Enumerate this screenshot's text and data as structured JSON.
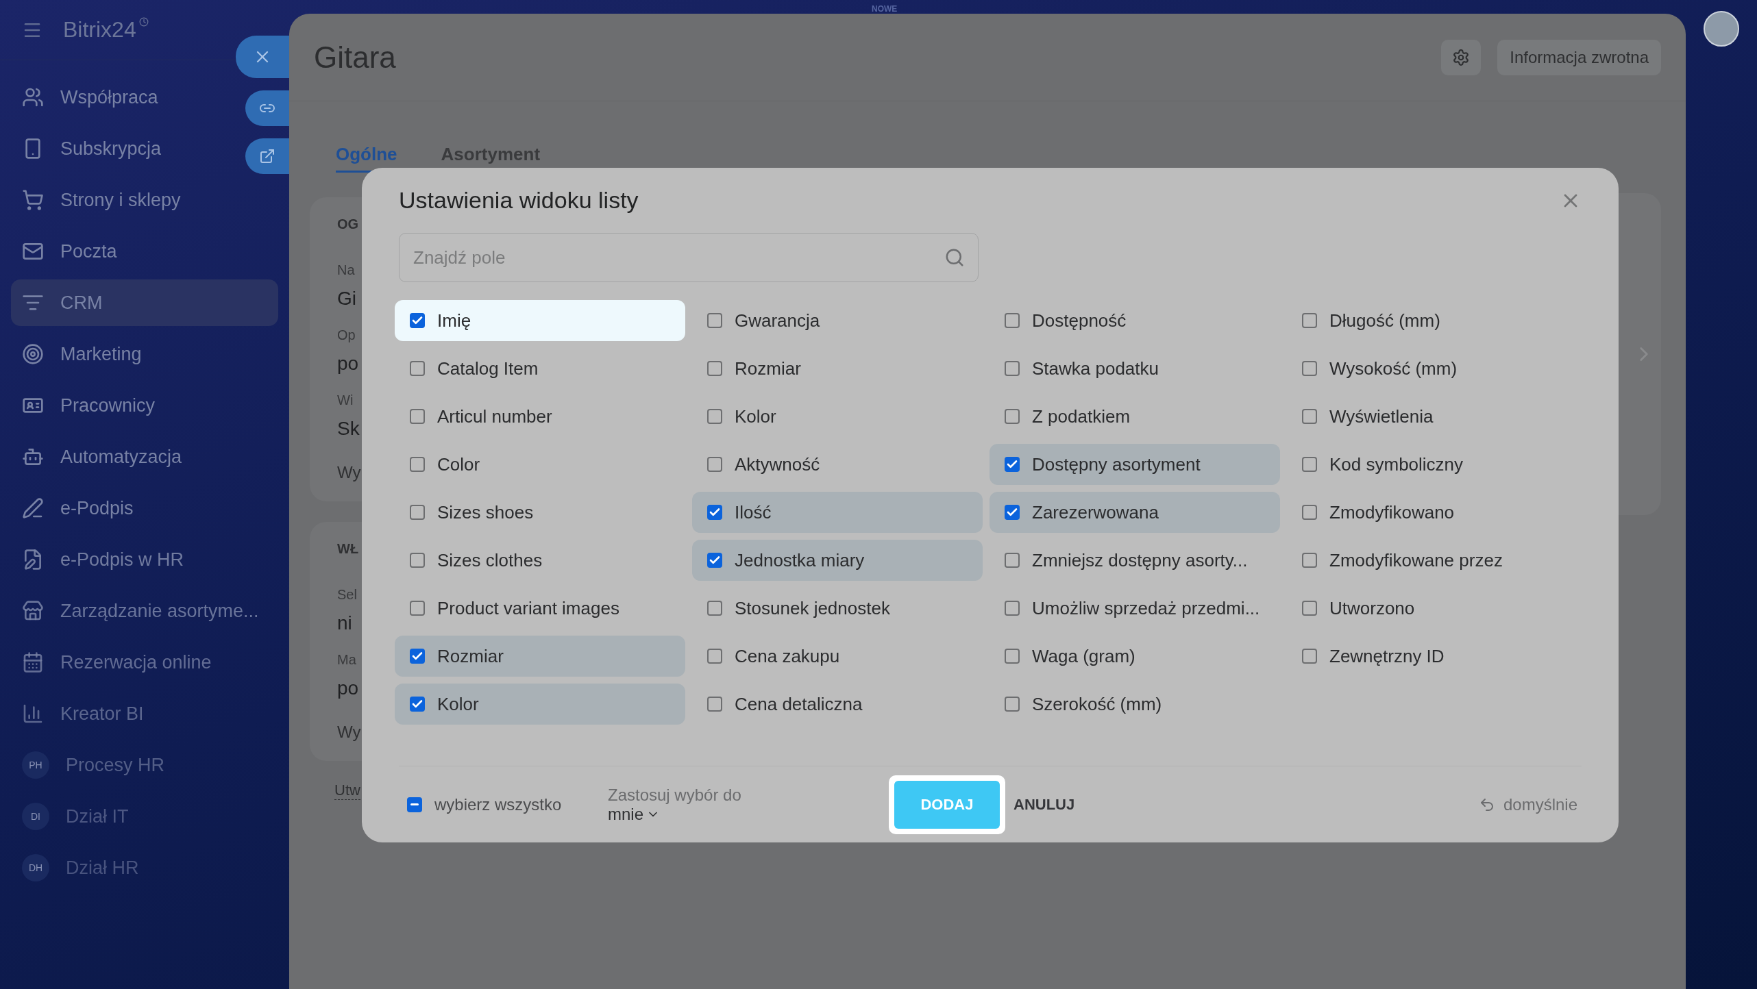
{
  "sidebar": {
    "logo": "Bitrix24",
    "items": [
      {
        "label": "Współpraca",
        "kind": "icon",
        "selected": false
      },
      {
        "label": "Subskrypcja",
        "kind": "icon",
        "selected": false
      },
      {
        "label": "Strony i sklepy",
        "kind": "icon",
        "selected": false
      },
      {
        "label": "Poczta",
        "kind": "icon",
        "selected": false
      },
      {
        "label": "CRM",
        "kind": "icon",
        "selected": true
      },
      {
        "label": "Marketing",
        "kind": "icon",
        "selected": false
      },
      {
        "label": "Pracownicy",
        "kind": "icon",
        "selected": false
      },
      {
        "label": "Automatyzacja",
        "kind": "icon",
        "selected": false
      },
      {
        "label": "e-Podpis",
        "kind": "icon",
        "selected": false
      },
      {
        "label": "e-Podpis w HR",
        "kind": "icon",
        "selected": false
      },
      {
        "label": "Zarządzanie asortyme...",
        "kind": "icon",
        "selected": false
      },
      {
        "label": "Rezerwacja online",
        "kind": "icon",
        "selected": false
      },
      {
        "label": "Kreator BI",
        "kind": "icon",
        "selected": false
      },
      {
        "label": "Procesy HR",
        "kind": "initials",
        "initials": "PH",
        "selected": false
      },
      {
        "label": "Dział IT",
        "kind": "initials",
        "initials": "DI",
        "selected": false
      },
      {
        "label": "Dział HR",
        "kind": "initials",
        "initials": "DH",
        "selected": false
      }
    ]
  },
  "top_badge": "NOWE",
  "panel": {
    "title": "Gitara",
    "feedback_button": "Informacja zwrotna",
    "tabs": [
      {
        "label": "Ogólne",
        "selected": true
      },
      {
        "label": "Asortyment",
        "selected": false
      }
    ],
    "sections": [
      {
        "heading": "OG",
        "fields": [
          {
            "label": "Na",
            "value": "Gi"
          },
          {
            "label": "Op",
            "value": "po"
          },
          {
            "label": "Wi",
            "value": "Sk"
          }
        ],
        "link": "Wy"
      },
      {
        "heading": "WŁ",
        "fields": [
          {
            "label": "Sel",
            "value": "ni"
          },
          {
            "label": "Ma",
            "value": "po"
          }
        ],
        "link": "Wy"
      }
    ],
    "footer_link": "Utw"
  },
  "dialog": {
    "title": "Ustawienia widoku listy",
    "search": {
      "placeholder": "Znajdź pole"
    },
    "columns": [
      [
        {
          "label": "Imię",
          "checked": true,
          "focused": true
        },
        {
          "label": "Catalog Item",
          "checked": false,
          "focused": false
        },
        {
          "label": "Articul number",
          "checked": false,
          "focused": false
        },
        {
          "label": "Color",
          "checked": false,
          "focused": false
        },
        {
          "label": "Sizes shoes",
          "checked": false,
          "focused": false
        },
        {
          "label": "Sizes clothes",
          "checked": false,
          "focused": false
        },
        {
          "label": "Product variant images",
          "checked": false,
          "focused": false
        },
        {
          "label": "Rozmiar",
          "checked": true,
          "focused": false
        },
        {
          "label": "Kolor",
          "checked": true,
          "focused": false
        }
      ],
      [
        {
          "label": "Gwarancja",
          "checked": false,
          "focused": false
        },
        {
          "label": "Rozmiar",
          "checked": false,
          "focused": false
        },
        {
          "label": "Kolor",
          "checked": false,
          "focused": false
        },
        {
          "label": "Aktywność",
          "checked": false,
          "focused": false
        },
        {
          "label": "Ilość",
          "checked": true,
          "focused": false
        },
        {
          "label": "Jednostka miary",
          "checked": true,
          "focused": false
        },
        {
          "label": "Stosunek jednostek",
          "checked": false,
          "focused": false
        },
        {
          "label": "Cena zakupu",
          "checked": false,
          "focused": false
        },
        {
          "label": "Cena detaliczna",
          "checked": false,
          "focused": false
        }
      ],
      [
        {
          "label": "Dostępność",
          "checked": false,
          "focused": false
        },
        {
          "label": "Stawka podatku",
          "checked": false,
          "focused": false
        },
        {
          "label": "Z podatkiem",
          "checked": false,
          "focused": false
        },
        {
          "label": "Dostępny asortyment",
          "checked": true,
          "focused": false
        },
        {
          "label": "Zarezerwowana",
          "checked": true,
          "focused": false
        },
        {
          "label": "Zmniejsz dostępny asorty...",
          "checked": false,
          "focused": false
        },
        {
          "label": "Umożliw sprzedaż przedmi...",
          "checked": false,
          "focused": false
        },
        {
          "label": "Waga (gram)",
          "checked": false,
          "focused": false
        },
        {
          "label": "Szerokość (mm)",
          "checked": false,
          "focused": false
        }
      ],
      [
        {
          "label": "Długość (mm)",
          "checked": false,
          "focused": false
        },
        {
          "label": "Wysokość (mm)",
          "checked": false,
          "focused": false
        },
        {
          "label": "Wyświetlenia",
          "checked": false,
          "focused": false
        },
        {
          "label": "Kod symboliczny",
          "checked": false,
          "focused": false
        },
        {
          "label": "Zmodyfikowano",
          "checked": false,
          "focused": false
        },
        {
          "label": "Zmodyfikowane przez",
          "checked": false,
          "focused": false
        },
        {
          "label": "Utworzono",
          "checked": false,
          "focused": false
        },
        {
          "label": "Zewnętrzny ID",
          "checked": false,
          "focused": false
        }
      ]
    ],
    "select_all": {
      "label": "wybierz wszystko",
      "indeterminate": true
    },
    "apply_to": {
      "label": "Zastosuj wybór do",
      "value": "mnie"
    },
    "add_button": "DODAJ",
    "cancel_button": "ANULUJ",
    "reset_link": "domyślnie"
  }
}
